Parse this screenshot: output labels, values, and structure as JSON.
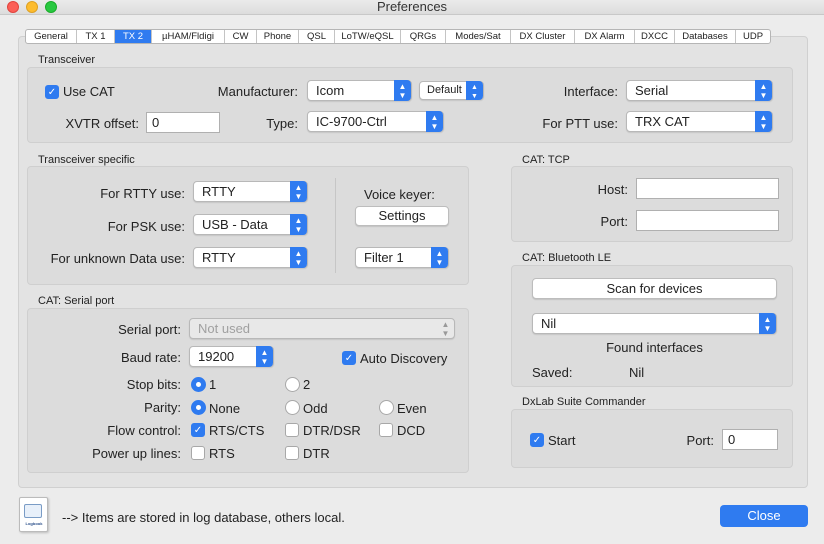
{
  "window": {
    "title": "Preferences"
  },
  "tabs": [
    "General",
    "TX 1",
    "TX 2",
    "µHAM/Fldigi",
    "CW",
    "Phone",
    "QSL",
    "LoTW/eQSL",
    "QRGs",
    "Modes/Sat",
    "DX Cluster",
    "DX Alarm",
    "DXCC",
    "Databases",
    "UDP"
  ],
  "selected_tab": "TX 2",
  "transceiver": {
    "group_title": "Transceiver",
    "use_cat_label": "Use CAT",
    "manufacturer_label": "Manufacturer:",
    "manufacturer_value": "Icom",
    "default_button": "Default",
    "interface_label": "Interface:",
    "interface_value": "Serial",
    "xvtr_label": "XVTR offset:",
    "xvtr_value": "0",
    "type_label": "Type:",
    "type_value": "IC-9700-Ctrl",
    "ptt_label": "For PTT use:",
    "ptt_value": "TRX CAT"
  },
  "specific": {
    "group_title": "Transceiver specific",
    "rtty_label": "For RTTY use:",
    "rtty_value": "RTTY",
    "psk_label": "For PSK use:",
    "psk_value": "USB - Data",
    "unknown_label": "For unknown Data use:",
    "unknown_value": "RTTY",
    "voice_keyer_label": "Voice keyer:",
    "settings_button": "Settings",
    "filter_value": "Filter 1"
  },
  "serial": {
    "group_title": "CAT: Serial port",
    "port_label": "Serial port:",
    "port_value": "Not used",
    "baud_label": "Baud rate:",
    "baud_value": "19200",
    "auto_discovery": "Auto Discovery",
    "stop_label": "Stop bits:",
    "stop_1": "1",
    "stop_2": "2",
    "parity_label": "Parity:",
    "parity_none": "None",
    "parity_odd": "Odd",
    "parity_even": "Even",
    "flow_label": "Flow control:",
    "flow_rts": "RTS/CTS",
    "flow_dtr": "DTR/DSR",
    "flow_dcd": "DCD",
    "power_label": "Power up lines:",
    "power_rts": "RTS",
    "power_dtr": "DTR"
  },
  "tcp": {
    "group_title": "CAT: TCP",
    "host_label": "Host:",
    "host_value": "",
    "port_label": "Port:",
    "port_value": ""
  },
  "ble": {
    "group_title": "CAT: Bluetooth LE",
    "scan_button": "Scan for devices",
    "device_value": "Nil",
    "found_label": "Found interfaces",
    "saved_label": "Saved:",
    "saved_value": "Nil"
  },
  "dxlab": {
    "group_title": "DxLab Suite Commander",
    "start_label": "Start",
    "port_label": "Port:",
    "port_value": "0"
  },
  "footer": {
    "icon_caption": "Logbook",
    "note": "--> Items are stored in log database, others local.",
    "close_button": "Close"
  }
}
